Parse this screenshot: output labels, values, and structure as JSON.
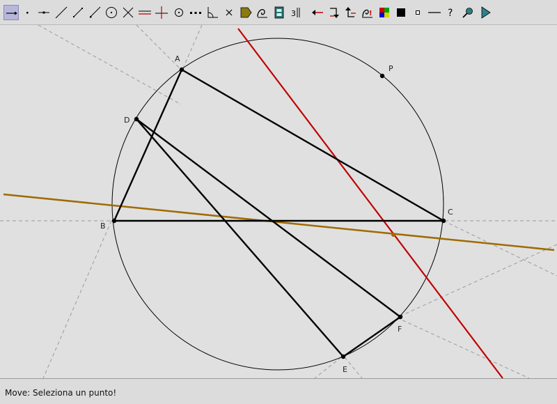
{
  "toolbar": {
    "tools": [
      {
        "name": "move-tool-icon",
        "selected": true
      },
      {
        "name": "point-tool-icon"
      },
      {
        "name": "point-on-object-icon"
      },
      {
        "name": "line-tool-icon"
      },
      {
        "name": "segment-tool-icon"
      },
      {
        "name": "ray-tool-icon"
      },
      {
        "name": "circle-tool-icon"
      },
      {
        "name": "intersection-tool-icon"
      },
      {
        "name": "parallel-line-icon"
      },
      {
        "name": "perpendicular-line-icon"
      },
      {
        "name": "circle-center-icon"
      },
      {
        "name": "midpoint-icon"
      },
      {
        "name": "angle-tool-icon"
      },
      {
        "name": "delete-tool-icon"
      },
      {
        "name": "polygon-tool-icon"
      },
      {
        "name": "locus-tool-icon"
      },
      {
        "name": "film-tool-icon"
      },
      {
        "name": "measure-tool-icon"
      },
      {
        "name": "undo-arrow-icon"
      },
      {
        "name": "redo-arrow-icon"
      },
      {
        "name": "back-arrow-icon"
      },
      {
        "name": "macro-tool-icon"
      },
      {
        "name": "color-palette-icon"
      },
      {
        "name": "filled-square-icon"
      },
      {
        "name": "small-square-icon"
      },
      {
        "name": "line-style-icon"
      },
      {
        "name": "help-icon"
      },
      {
        "name": "settings-icon"
      },
      {
        "name": "play-icon"
      }
    ]
  },
  "canvas": {
    "points": [
      {
        "label": "A"
      },
      {
        "label": "B"
      },
      {
        "label": "C"
      },
      {
        "label": "D"
      },
      {
        "label": "E"
      },
      {
        "label": "F"
      },
      {
        "label": "P"
      }
    ],
    "colors": {
      "segments": "#000000",
      "red_line": "#c00000",
      "orange_line": "#a06a00",
      "construction": "#9a9a9a",
      "circle": "#000000"
    }
  },
  "status": {
    "text": "Move: Seleziona un punto!"
  }
}
